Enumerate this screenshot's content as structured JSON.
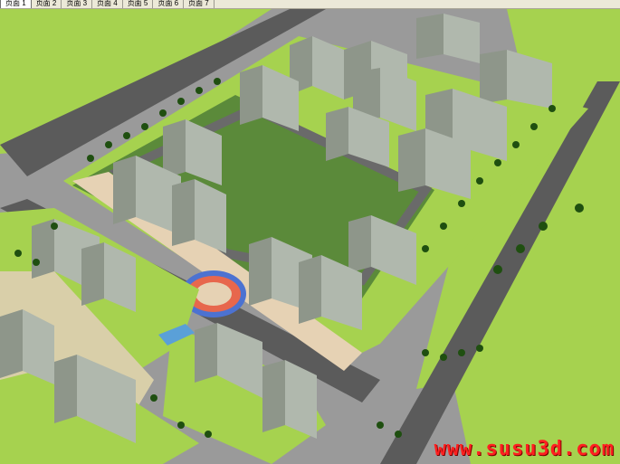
{
  "tabs": [
    {
      "label": "页面 1",
      "active": true
    },
    {
      "label": "页面 2",
      "active": false
    },
    {
      "label": "页面 3",
      "active": false
    },
    {
      "label": "页面 4",
      "active": false
    },
    {
      "label": "页面 5",
      "active": false
    },
    {
      "label": "页面 6",
      "active": false
    },
    {
      "label": "页面 7",
      "active": false
    }
  ],
  "viewport": {
    "watermark": "www.susu3d.com"
  },
  "colors": {
    "ground_grey": "#9a9a9a",
    "lawn_green": "#a6d24f",
    "dark_green": "#4f8a2b",
    "road": "#5b5b5b",
    "plaza_beige": "#e6d2b4",
    "tower_glass": "#9da59a",
    "accent_red": "#ff2020"
  }
}
